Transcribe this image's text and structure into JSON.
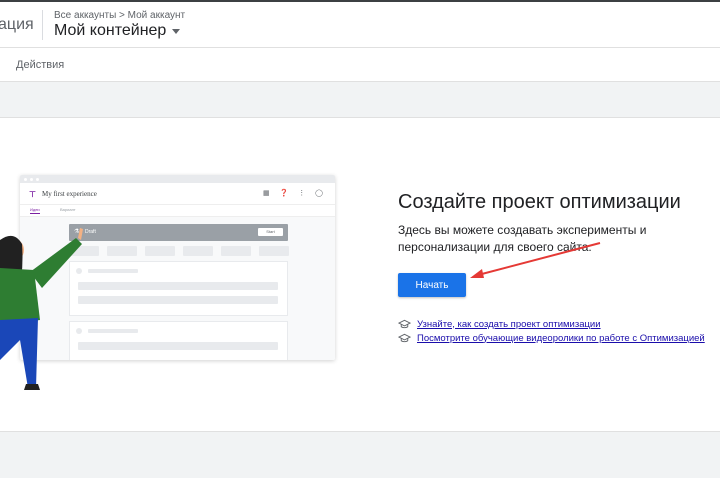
{
  "header": {
    "app_title_partial": "ация",
    "breadcrumb": "Все аккаунты > Мой аккаунт",
    "container_name": "Мой контейнер"
  },
  "subnav": {
    "actions_label": "Действия"
  },
  "illustration": {
    "mock_title": "My first experience",
    "tab_active": "Идеи",
    "tab_inactive": "Вариант",
    "draft_label": "Draft",
    "draft_button": "Start"
  },
  "main": {
    "heading": "Создайте проект оптимизации",
    "description": "Здесь вы можете создавать эксперименты и персонализации для своего сайта.",
    "start_button": "Начать",
    "links": [
      {
        "icon": "graduation-cap-icon",
        "label": "Узнайте, как создать проект оптимизации"
      },
      {
        "icon": "graduation-cap-icon",
        "label": "Посмотрите обучающие видеоролики по работе с Оптимизацией"
      }
    ]
  },
  "colors": {
    "accent": "#1a73e8",
    "annotation_arrow": "#e53935",
    "link": "#1a0dab"
  }
}
